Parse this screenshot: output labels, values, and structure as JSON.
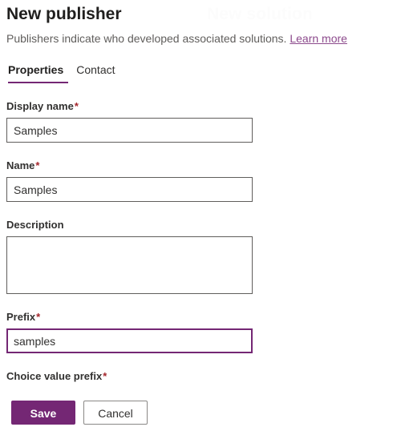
{
  "header": {
    "title": "New publisher",
    "subtitle_text": "Publishers indicate who developed associated solutions.",
    "learn_more_label": "Learn more"
  },
  "background_ghost": {
    "title": "New solution",
    "subtitle": ""
  },
  "tabs": [
    {
      "label": "Properties",
      "active": true
    },
    {
      "label": "Contact",
      "active": false
    }
  ],
  "form": {
    "fields": [
      {
        "label": "Display name",
        "required_marker": "*",
        "value": "Samples",
        "placeholder": "",
        "type": "text",
        "focused": false
      },
      {
        "label": "Name",
        "required_marker": "*",
        "value": "Samples",
        "placeholder": "",
        "type": "text",
        "focused": false
      },
      {
        "label": "Description",
        "required_marker": "",
        "value": "",
        "placeholder": "",
        "type": "textarea",
        "focused": false
      },
      {
        "label": "Prefix",
        "required_marker": "*",
        "value": "samples",
        "placeholder": "",
        "type": "text",
        "focused": true
      },
      {
        "label": "Choice value prefix",
        "required_marker": "*",
        "value": "",
        "placeholder": "",
        "type": "text",
        "focused": false
      }
    ]
  },
  "footer": {
    "save_label": "Save",
    "cancel_label": "Cancel"
  },
  "colors": {
    "brand_purple": "#742774",
    "link_purple": "#8c4a8c",
    "required_red": "#a4262c",
    "text_primary": "#323130",
    "text_secondary": "#605e5c",
    "input_border": "#605e5c"
  }
}
